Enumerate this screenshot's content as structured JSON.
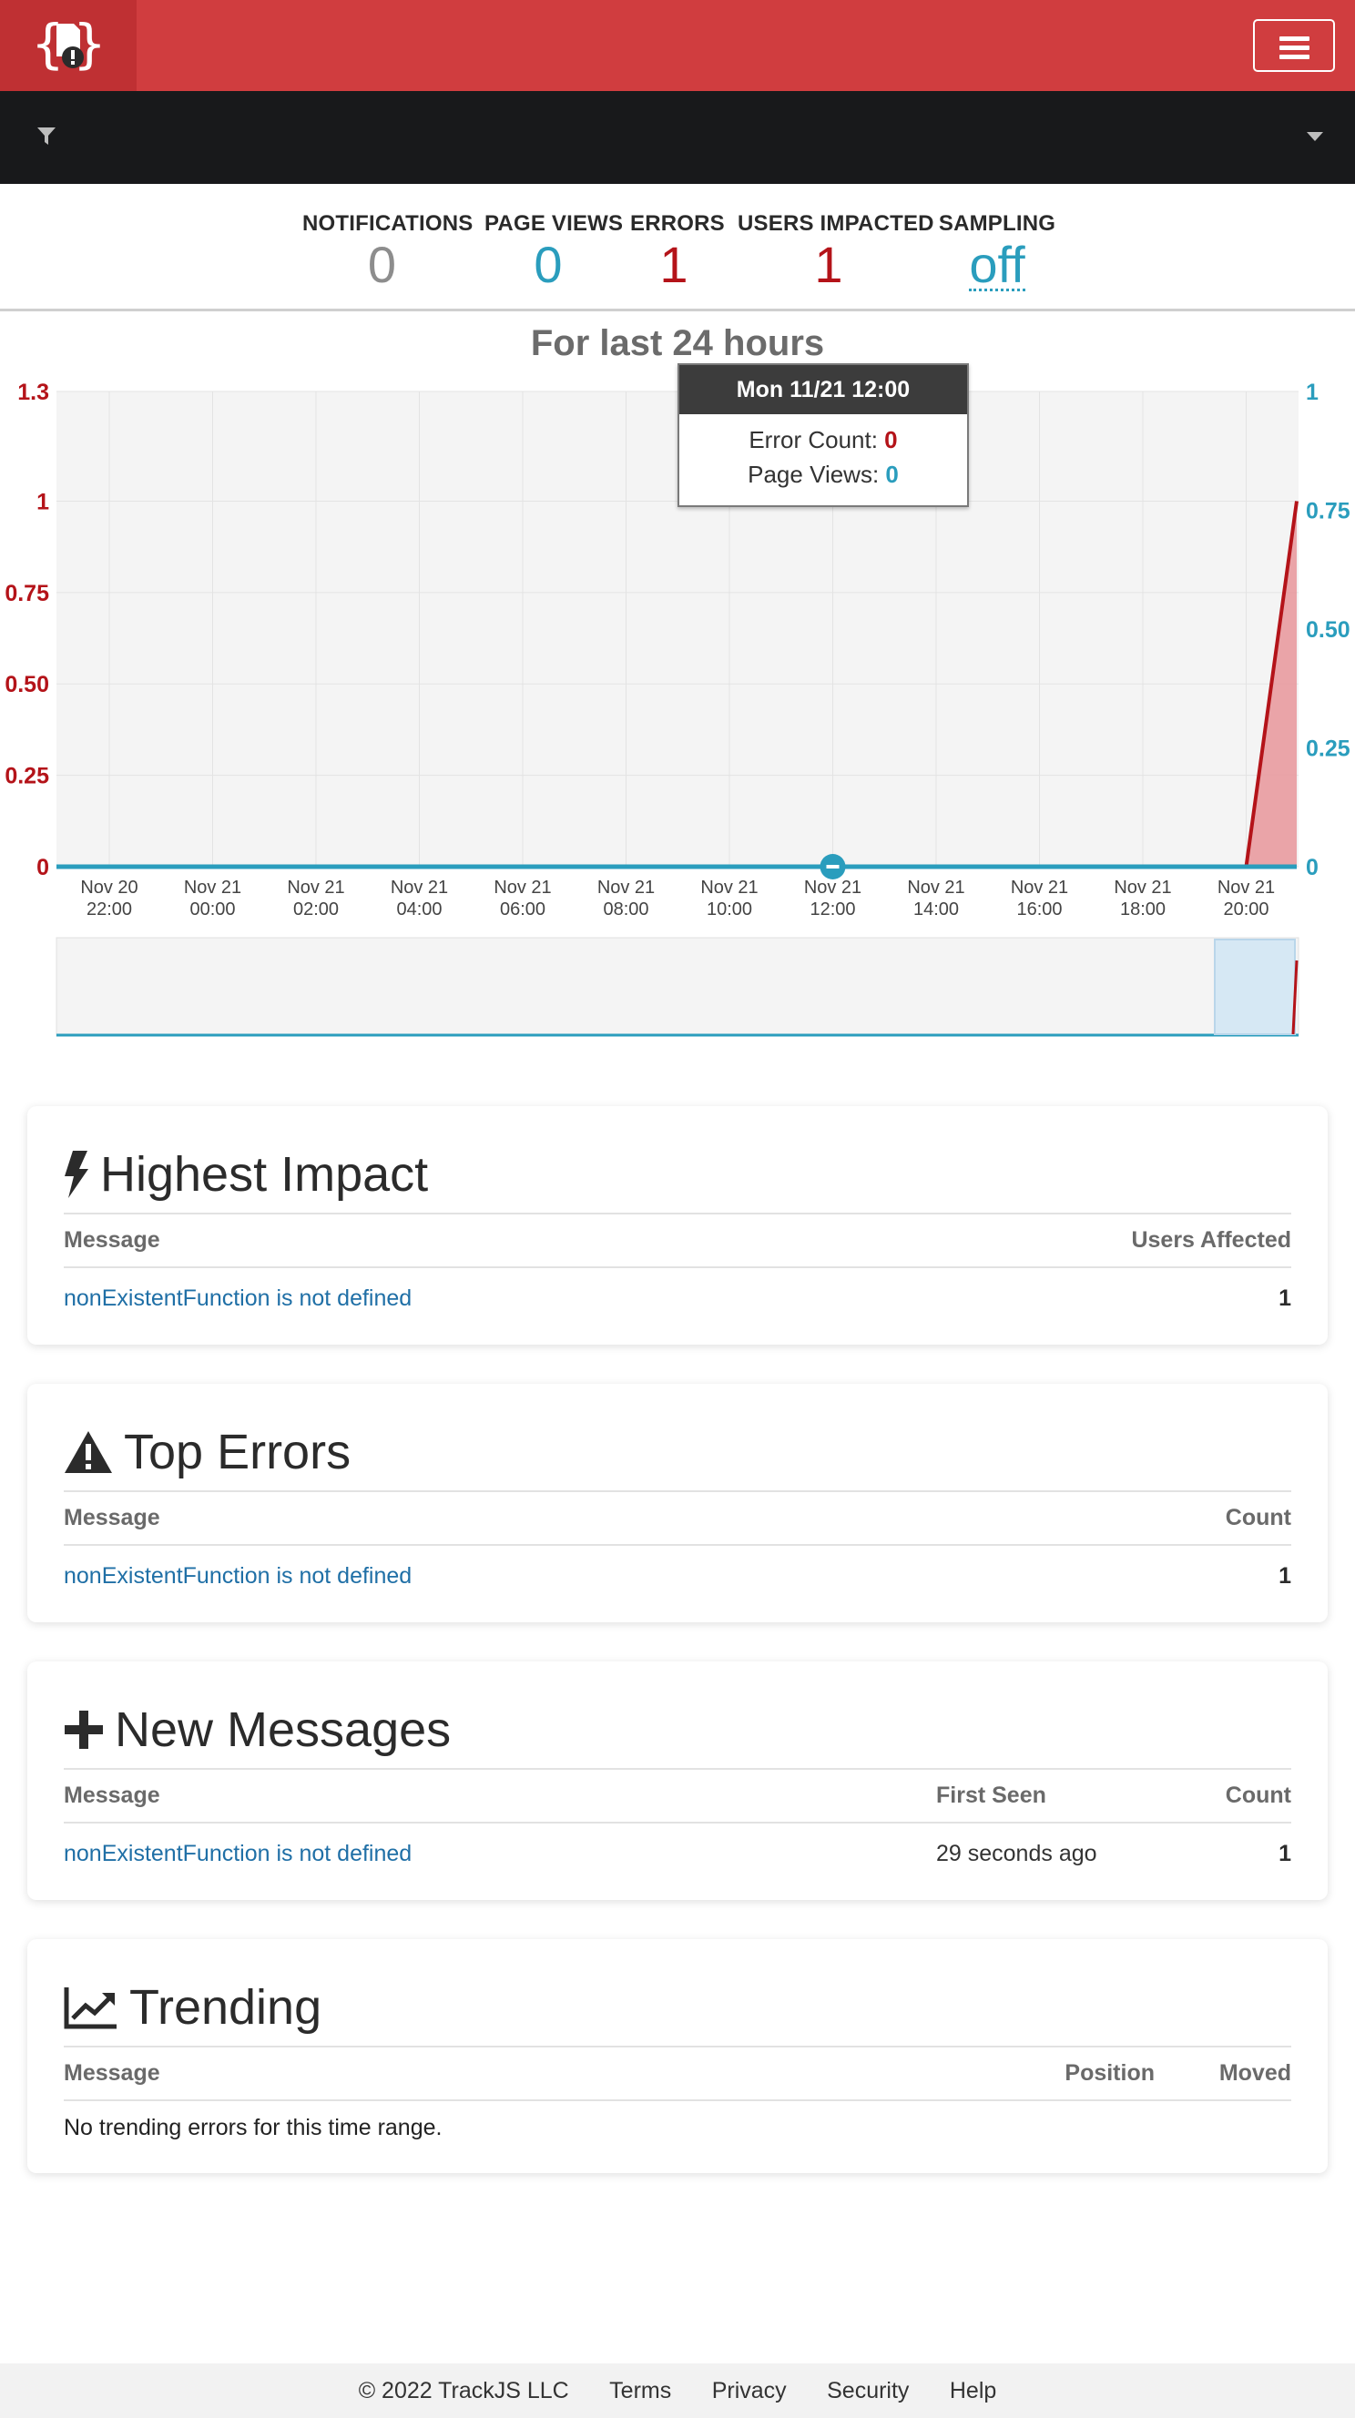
{
  "header": {
    "logo_icon": "trackjs-logo-icon",
    "menu_icon": "hamburger-icon",
    "brand_color": "#d03d3f"
  },
  "filter": {
    "icon": "filter-icon",
    "caret": "caret-down-icon"
  },
  "stats": [
    {
      "label": "NOTIFICATIONS",
      "value": "0",
      "color": "#8d8d8d"
    },
    {
      "label": "PAGE VIEWS",
      "value": "0",
      "color": "#2a9dbd"
    },
    {
      "label": "ERRORS",
      "value": "1",
      "color": "#b41319"
    },
    {
      "label": "USERS IMPACTED",
      "value": "1",
      "color": "#b41319"
    },
    {
      "label": "SAMPLING",
      "value": "off",
      "color": "#2a9dbd"
    }
  ],
  "chart_title": "For last 24 hours",
  "chart_data": {
    "type": "area",
    "title": "For last 24 hours",
    "x": [
      "Nov 20 22:00",
      "Nov 21 00:00",
      "Nov 21 02:00",
      "Nov 21 04:00",
      "Nov 21 06:00",
      "Nov 21 08:00",
      "Nov 21 10:00",
      "Nov 21 12:00",
      "Nov 21 14:00",
      "Nov 21 16:00",
      "Nov 21 18:00",
      "Nov 21 20:00",
      "Nov 21 21:00"
    ],
    "x_ticks": [
      {
        "line1": "Nov 20",
        "line2": "22:00"
      },
      {
        "line1": "Nov 21",
        "line2": "00:00"
      },
      {
        "line1": "Nov 21",
        "line2": "02:00"
      },
      {
        "line1": "Nov 21",
        "line2": "04:00"
      },
      {
        "line1": "Nov 21",
        "line2": "06:00"
      },
      {
        "line1": "Nov 21",
        "line2": "08:00"
      },
      {
        "line1": "Nov 21",
        "line2": "10:00"
      },
      {
        "line1": "Nov 21",
        "line2": "12:00"
      },
      {
        "line1": "Nov 21",
        "line2": "14:00"
      },
      {
        "line1": "Nov 21",
        "line2": "16:00"
      },
      {
        "line1": "Nov 21",
        "line2": "18:00"
      },
      {
        "line1": "Nov 21",
        "line2": "20:00"
      }
    ],
    "series": [
      {
        "name": "Error Count",
        "axis": "left",
        "color": "#b41319",
        "values": [
          0,
          0,
          0,
          0,
          0,
          0,
          0,
          0,
          0,
          0,
          0,
          0,
          1
        ]
      },
      {
        "name": "Page Views",
        "axis": "right",
        "color": "#2a9dbd",
        "values": [
          0,
          0,
          0,
          0,
          0,
          0,
          0,
          0,
          0,
          0,
          0,
          0,
          0
        ]
      }
    ],
    "y_left": {
      "ticks": [
        "1.3",
        "1",
        "0.75",
        "0.50",
        "0.25",
        "0"
      ],
      "ylim": [
        0,
        1.3
      ]
    },
    "y_right": {
      "ticks": [
        "1",
        "0.75",
        "0.50",
        "0.25",
        "0"
      ],
      "ylim": [
        0,
        1
      ]
    },
    "grid": true,
    "navigator": true
  },
  "tooltip": {
    "title": "Mon 11/21 12:00",
    "error_label": "Error Count: ",
    "error_value": "0",
    "views_label": "Page Views: ",
    "views_value": "0"
  },
  "cards": {
    "highest_impact": {
      "icon": "bolt-icon",
      "title": "Highest Impact",
      "col_message": "Message",
      "col_right": "Users Affected",
      "rows": [
        {
          "message": "nonExistentFunction is not defined",
          "value": "1"
        }
      ]
    },
    "top_errors": {
      "icon": "warning-icon",
      "title": "Top Errors",
      "col_message": "Message",
      "col_right": "Count",
      "rows": [
        {
          "message": "nonExistentFunction is not defined",
          "value": "1"
        }
      ]
    },
    "new_messages": {
      "icon": "plus-icon",
      "title": "New Messages",
      "col_message": "Message",
      "col_first_seen": "First Seen",
      "col_right": "Count",
      "rows": [
        {
          "message": "nonExistentFunction is not defined",
          "first_seen": "29 seconds ago",
          "value": "1"
        }
      ]
    },
    "trending": {
      "icon": "trend-chart-icon",
      "title": "Trending",
      "col_message": "Message",
      "col_position": "Position",
      "col_moved": "Moved",
      "empty_text": "No trending errors for this time range."
    }
  },
  "footer": {
    "copyright": "© 2022 TrackJS LLC",
    "links": [
      "Terms",
      "Privacy",
      "Security",
      "Help"
    ]
  }
}
